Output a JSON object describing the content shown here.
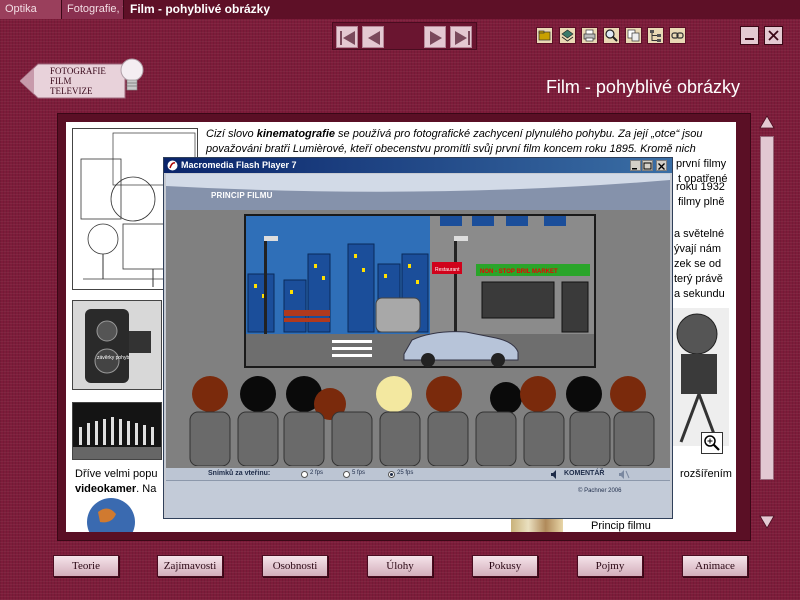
{
  "breadcrumbs": [
    "Optika",
    "Fotografie, fi",
    "Film - pohyblivé obrázky"
  ],
  "toolbar": {
    "nav": [
      "first-icon",
      "prev-icon",
      "next-icon",
      "last-icon"
    ],
    "tools": [
      "folder-icon",
      "stack-icon",
      "print-icon",
      "search-icon",
      "copy-icon",
      "tree-icon",
      "link-icon"
    ],
    "window": [
      "minimize-icon",
      "close-icon"
    ]
  },
  "logo": {
    "lines": [
      "FOTOGRAFIE",
      "FILM",
      "TELEVIZE"
    ]
  },
  "page_title": "Film - pohyblivé obrázky",
  "content": {
    "intro_1": "Cizí slovo ",
    "intro_kw": "kinematografie",
    "intro_2": " se používá pro fotografické zachycení plynulého pohybu. Za její „otce“ jsou považováni bratři Lumièrové, kteří obecenstvu promítli svůj první film koncem roku 1895. Kromě nich",
    "right_fragments": [
      "první filmy",
      "t opatřené",
      "roku 1932",
      "filmy plně",
      "a světelné",
      "ývají nám",
      "zek se od",
      "terý právě",
      "a sekundu"
    ],
    "bottom_left": "Dříve velmi popu",
    "bottom_right": "rozšířením",
    "bottom_kw": "videokamer",
    "bottom_rest": ". Na",
    "caption": "Princip filmu",
    "camera_label": "závěrky pohyb",
    "magnifier": "zoom-in-icon"
  },
  "flash": {
    "title": "Macromedia Flash Player 7",
    "banner": "PRINCIP FILMU",
    "sign": "Restaurant",
    "shop": "NON - STOP  BRIL  MARKET",
    "fps_label": "Snímků za vteřinu:",
    "fps_options": [
      "2 fps",
      "5 fps",
      "25 fps"
    ],
    "fps_selected": "25 fps",
    "comment": "KOMENTÁŘ",
    "copyright": "© Pachner 2006"
  },
  "menu": [
    "Teorie",
    "Zajímavosti",
    "Osobnosti",
    "Úlohy",
    "Pokusy",
    "Pojmy",
    "Animace"
  ]
}
